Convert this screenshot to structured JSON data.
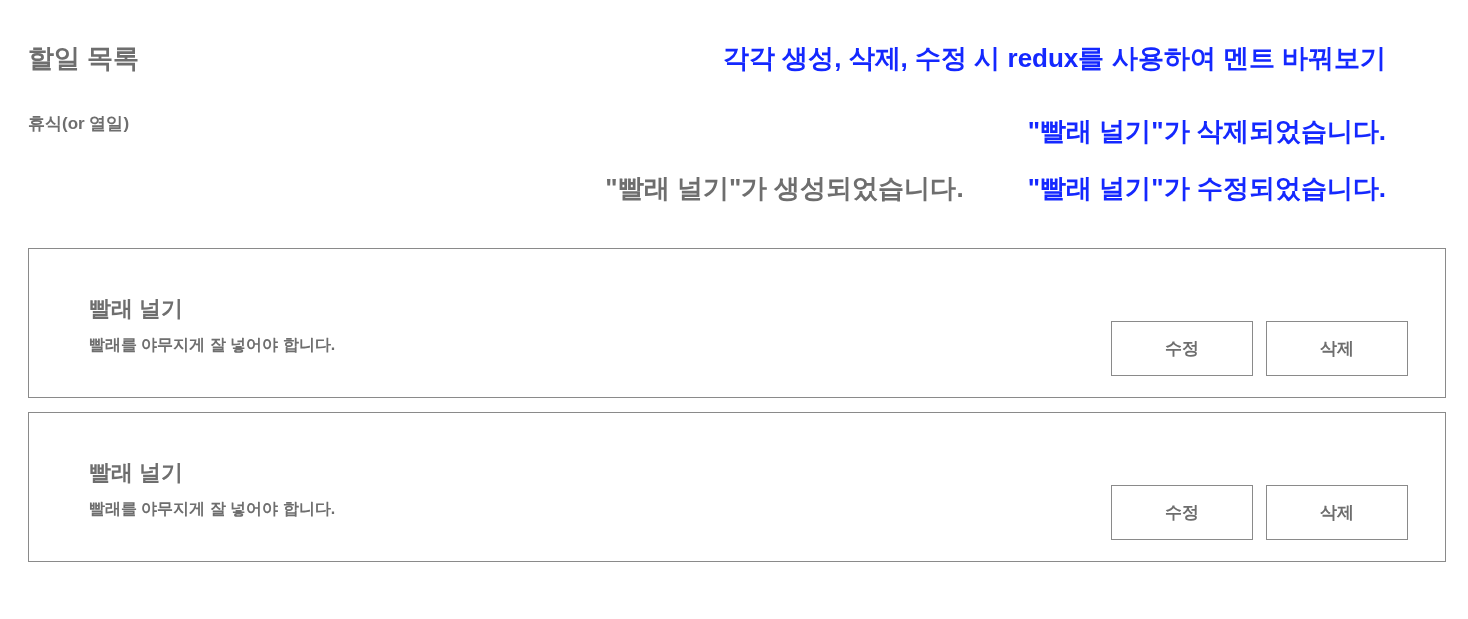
{
  "page": {
    "title": "할일 목록",
    "subtitle": "휴식(or 열일)",
    "status_message": "\"빨래 널기\"가 생성되었습니다."
  },
  "annotations": [
    {
      "text": "각각 생성, 삭제, 수정 시 redux를 사용하여 멘트 바꿔보기"
    },
    {
      "text": "\"빨래 널기\"가 삭제되었습니다."
    },
    {
      "text": "\"빨래 널기\"가 수정되었습니다."
    }
  ],
  "todos": [
    {
      "title": "빨래 널기",
      "description": "빨래를 야무지게 잘 넣어야 합니다.",
      "buttons": [
        "수정",
        "삭제"
      ]
    },
    {
      "title": "빨래 널기",
      "description": "빨래를 야무지게 잘 넣어야 합니다.",
      "buttons": [
        "수정",
        "삭제"
      ]
    }
  ]
}
